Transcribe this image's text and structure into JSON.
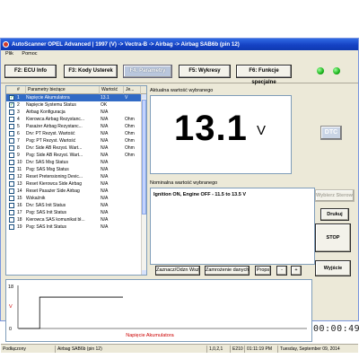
{
  "window": {
    "title": "AutoScanner OPEL Advanced | 1997 (V) -> Vectra-B -> Airbag -> Airbag SAB6b (pin 12)"
  },
  "menu": {
    "items": [
      "Plik",
      "Pomoc"
    ]
  },
  "tabs": [
    {
      "label": "F2: ECU Info"
    },
    {
      "label": "F3: Kody Usterek"
    },
    {
      "label": "F4: Parametry"
    },
    {
      "label": "F5: Wykresy"
    },
    {
      "label": "F6: Funkcje specjalne"
    }
  ],
  "table": {
    "headers": [
      "#",
      "Parametry bieżące",
      "Wartość",
      "Je..."
    ],
    "rows": [
      {
        "checked": true,
        "num": "1",
        "name": "Napięcie Akumulatora",
        "value": "13.1",
        "unit": "V"
      },
      {
        "checked": true,
        "num": "2",
        "name": "Napięcie Systemu Status",
        "value": "OK",
        "unit": ""
      },
      {
        "checked": false,
        "num": "3",
        "name": "Airbag Konfiguracja",
        "value": "N/A",
        "unit": ""
      },
      {
        "checked": false,
        "num": "4",
        "name": "Kierowca Airbag Rezystanc...",
        "value": "N/A",
        "unit": "Ohm"
      },
      {
        "checked": false,
        "num": "5",
        "name": "Pasażer Airbag Rezystanc...",
        "value": "N/A",
        "unit": "Ohm"
      },
      {
        "checked": false,
        "num": "6",
        "name": "Drv: PT Rezyst. Wartość",
        "value": "N/A",
        "unit": "Ohm"
      },
      {
        "checked": false,
        "num": "7",
        "name": "Psg: PT Rezyst. Wartość",
        "value": "N/A",
        "unit": "Ohm"
      },
      {
        "checked": false,
        "num": "8",
        "name": "Drv: Side AB Rezyst. Wart...",
        "value": "N/A",
        "unit": "Ohm"
      },
      {
        "checked": false,
        "num": "9",
        "name": "Psg: Side AB Rezyst. Wart...",
        "value": "N/A",
        "unit": "Ohm"
      },
      {
        "checked": false,
        "num": "10",
        "name": "Drv: SAS Msg Status",
        "value": "N/A",
        "unit": ""
      },
      {
        "checked": false,
        "num": "11",
        "name": "Psg: SAS Msg Status",
        "value": "N/A",
        "unit": ""
      },
      {
        "checked": false,
        "num": "12",
        "name": "Reset Pretensioning Devic...",
        "value": "N/A",
        "unit": ""
      },
      {
        "checked": false,
        "num": "13",
        "name": "Reset Kierowca Side Airbag",
        "value": "N/A",
        "unit": ""
      },
      {
        "checked": false,
        "num": "14",
        "name": "Reset Pasażer Side Airbag",
        "value": "N/A",
        "unit": ""
      },
      {
        "checked": false,
        "num": "15",
        "name": "Wskaźnik",
        "value": "N/A",
        "unit": ""
      },
      {
        "checked": false,
        "num": "16",
        "name": "Drv: SAS Init Status",
        "value": "N/A",
        "unit": ""
      },
      {
        "checked": false,
        "num": "17",
        "name": "Psg: SAS Init Status",
        "value": "N/A",
        "unit": ""
      },
      {
        "checked": false,
        "num": "18",
        "name": "Kierowca SAS komunikat bł...",
        "value": "N/A",
        "unit": ""
      },
      {
        "checked": false,
        "num": "19",
        "name": "Psg: SAS Init Status",
        "value": "N/A",
        "unit": ""
      }
    ]
  },
  "current": {
    "label": "Aktualna wartość wybranego",
    "value": "13.1",
    "unit": "V"
  },
  "nominal": {
    "label": "Nominalna wartość wybranego",
    "text": "Ignition ON, Engine OFF - 11.5 to 13.5 V"
  },
  "buttons": {
    "dtc": "DTC",
    "select_module": "Wybierz Sterown",
    "print": "Drukuj",
    "mark_all": "Zaznacz/Odzn Wszystkie",
    "save_data": "Zamrożenie danych",
    "props": "Props",
    "minus": "-",
    "plus": "+",
    "stop": "STOP",
    "exit": "Wyjście"
  },
  "graph": {
    "y_max_label": "18",
    "y_min_label": "0",
    "unit": "V",
    "series_label": "Napięcie Akumulatora"
  },
  "chart_data": {
    "type": "line",
    "series": [
      {
        "name": "Napięcie Akumulatora",
        "values": [
          0,
          13.1,
          13.1,
          13.1,
          13.1,
          13.1
        ]
      }
    ],
    "ylim": [
      0,
      18
    ]
  },
  "timer": "00:00:49",
  "status": {
    "state": "Podłączony",
    "module": "Airbag SAB6b (pin 12)",
    "version": "1,0,2,1",
    "code": "E210",
    "time": "01:11:19 PM",
    "date": "Tuesday, September 09, 2014"
  },
  "colors": {
    "title_bar": "#1542c4",
    "selected_row": "#316ac5",
    "led": "#19b319",
    "graph_line": "#000000",
    "graph_label": "#cc0000"
  }
}
